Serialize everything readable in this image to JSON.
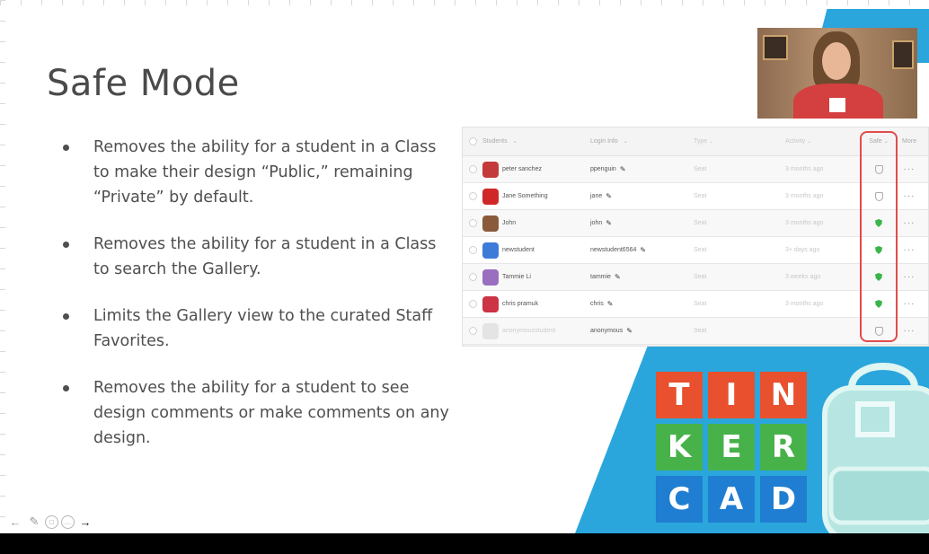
{
  "slide": {
    "title": "Safe Mode",
    "bullets": [
      "Removes the ability for a student in a Class to make their design “Public,” remaining “Private” by default.",
      "Removes the ability for a student in a Class to search the Gallery.",
      "Limits the Gallery view to the curated Staff Favorites.",
      "Removes the ability for a student to see design comments or make comments on any design."
    ]
  },
  "table": {
    "headers": {
      "students": "Students",
      "login": "Login Info",
      "type": "Type",
      "activity": "Activity",
      "safe": "Safe",
      "more": "More"
    },
    "rows": [
      {
        "name": "peter sanchez",
        "login": "ppenguin",
        "type": "Seat",
        "activity": "3 months ago",
        "safe": false,
        "avatar_color": "#c43a3a"
      },
      {
        "name": "Jane Something",
        "login": "jane",
        "type": "Seat",
        "activity": "3 months ago",
        "safe": false,
        "avatar_color": "#d02828"
      },
      {
        "name": "John",
        "login": "john",
        "type": "Seat",
        "activity": "3 months ago",
        "safe": true,
        "avatar_color": "#8a5a3a"
      },
      {
        "name": "newstudent",
        "login": "newstudent6564",
        "type": "Seat",
        "activity": "3+ days ago",
        "safe": true,
        "avatar_color": "#3d7bd8"
      },
      {
        "name": "Tammie Li",
        "login": "tammie",
        "type": "Seat",
        "activity": "3 weeks ago",
        "safe": true,
        "avatar_color": "#9a6fc0"
      },
      {
        "name": "chris pramuk",
        "login": "chris",
        "type": "Seat",
        "activity": "3 months ago",
        "safe": true,
        "avatar_color": "#cc3344"
      },
      {
        "name": "anonymousstudent",
        "login": "anonymous",
        "type": "Seat",
        "activity": "",
        "safe": false,
        "avatar_color": "#e4e4e4"
      }
    ]
  },
  "logo": {
    "letters": [
      "T",
      "I",
      "N",
      "K",
      "E",
      "R",
      "C",
      "A",
      "D"
    ],
    "colors": [
      "#e8502e",
      "#e8502e",
      "#e8502e",
      "#48b24a",
      "#48b24a",
      "#48b24a",
      "#1f7ed1",
      "#1f7ed1",
      "#1f7ed1"
    ]
  },
  "controls": {
    "prev_icon": "←",
    "pen_icon": "✎",
    "slides_icon": "□",
    "more_icon": "…",
    "next_icon": "→"
  },
  "theme": {
    "accent_blue": "#2aa6dc",
    "highlight_red": "#e34b4b",
    "safe_green": "#3ab54a"
  }
}
